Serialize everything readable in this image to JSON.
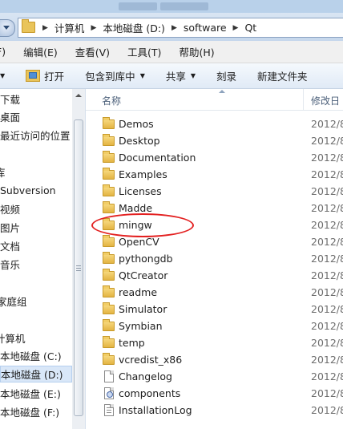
{
  "address": {
    "crumbs": [
      "计算机",
      "本地磁盘 (D:)",
      "software",
      "Qt"
    ]
  },
  "menu": [
    "F)",
    "编辑(E)",
    "查看(V)",
    "工具(T)",
    "帮助(H)"
  ],
  "toolbar": {
    "open_label": "打开",
    "include_label": "包含到库中",
    "share_label": "共享",
    "burn_label": "刻录",
    "new_folder_label": "新建文件夹"
  },
  "nav": {
    "items": [
      "下载",
      "桌面",
      "最近访问的位置",
      "库",
      "Subversion",
      "视频",
      "图片",
      "文档",
      "音乐",
      "家庭组",
      "计算机",
      "本地磁盘 (C:)",
      "本地磁盘 (D:)",
      "本地磁盘 (E:)",
      "本地磁盘 (F:)"
    ],
    "selected": "本地磁盘 (D:)"
  },
  "files": {
    "header_name": "名称",
    "header_date": "修改日",
    "items": [
      {
        "name": "Demos",
        "date": "2012/8",
        "type": "folder"
      },
      {
        "name": "Desktop",
        "date": "2012/8",
        "type": "folder"
      },
      {
        "name": "Documentation",
        "date": "2012/8",
        "type": "folder"
      },
      {
        "name": "Examples",
        "date": "2012/8",
        "type": "folder"
      },
      {
        "name": "Licenses",
        "date": "2012/8",
        "type": "folder"
      },
      {
        "name": "Madde",
        "date": "2012/8",
        "type": "folder"
      },
      {
        "name": "mingw",
        "date": "2012/8",
        "type": "folder"
      },
      {
        "name": "OpenCV",
        "date": "2012/8",
        "type": "folder"
      },
      {
        "name": "pythongdb",
        "date": "2012/8",
        "type": "folder"
      },
      {
        "name": "QtCreator",
        "date": "2012/8",
        "type": "folder"
      },
      {
        "name": "readme",
        "date": "2012/8",
        "type": "folder"
      },
      {
        "name": "Simulator",
        "date": "2012/8",
        "type": "folder"
      },
      {
        "name": "Symbian",
        "date": "2012/8",
        "type": "folder"
      },
      {
        "name": "temp",
        "date": "2012/8",
        "type": "folder"
      },
      {
        "name": "vcredist_x86",
        "date": "2012/8",
        "type": "folder"
      },
      {
        "name": "Changelog",
        "date": "2012/8",
        "type": "file"
      },
      {
        "name": "components",
        "date": "2012/8",
        "type": "config"
      },
      {
        "name": "InstallationLog",
        "date": "2012/8",
        "type": "text"
      }
    ]
  },
  "colors": {
    "annotation": "#e32121",
    "folder": "#e3b443",
    "selected_bg": "#d9e7f8"
  }
}
